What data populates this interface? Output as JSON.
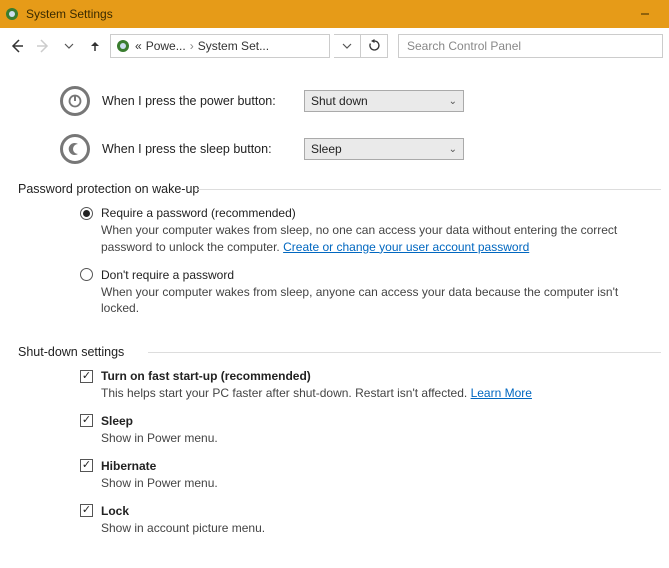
{
  "window": {
    "title": "System Settings"
  },
  "nav": {
    "breadcrumb_prefix": "«",
    "breadcrumb_item1": "Powe...",
    "breadcrumb_item2": "System Set...",
    "dropdown_chev": "⌄"
  },
  "search": {
    "placeholder": "Search Control Panel"
  },
  "power_button": {
    "label": "When I press the power button:",
    "value": "Shut down"
  },
  "sleep_button": {
    "label": "When I press the sleep button:",
    "value": "Sleep"
  },
  "password_section": {
    "heading": "Password protection on wake-up",
    "require": {
      "label": "Require a password (recommended)",
      "desc_pre": "When your computer wakes from sleep, no one can access your data without entering the correct password to unlock the computer. ",
      "link": "Create or change your user account password"
    },
    "dont_require": {
      "label": "Don't require a password",
      "desc": "When your computer wakes from sleep, anyone can access your data because the computer isn't locked."
    }
  },
  "shutdown_section": {
    "heading": "Shut-down settings",
    "fast_startup": {
      "label": "Turn on fast start-up (recommended)",
      "desc_pre": "This helps start your PC faster after shut-down. Restart isn't affected. ",
      "link": "Learn More"
    },
    "sleep": {
      "label": "Sleep",
      "desc": "Show in Power menu."
    },
    "hibernate": {
      "label": "Hibernate",
      "desc": "Show in Power menu."
    },
    "lock": {
      "label": "Lock",
      "desc": "Show in account picture menu."
    }
  }
}
